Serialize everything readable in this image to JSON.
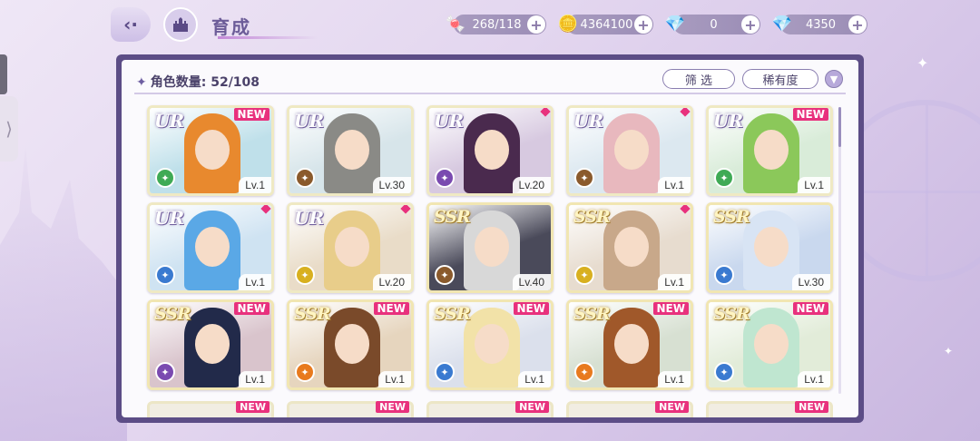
{
  "header": {
    "title": "育成",
    "back_icon": "back-arrow-icon",
    "home_icon": "castle-home-icon"
  },
  "currencies": [
    {
      "name": "candy",
      "icon": "🍬",
      "value": "268/118"
    },
    {
      "name": "coin",
      "icon": "🪙",
      "value": "4364100"
    },
    {
      "name": "pink-diamond",
      "icon": "💎",
      "value": "0"
    },
    {
      "name": "blue-diamond",
      "icon": "💎",
      "value": "4350"
    }
  ],
  "panel": {
    "count_label": "角色数量: 52/108",
    "filter_label": "筛 选",
    "rarity_label": "稀有度",
    "dropdown_icon": "chevron-down-icon"
  },
  "colors": {
    "new_tag": "#e8317d",
    "panel_frame": "#5c4d86",
    "accent": "#6d5da0"
  },
  "cards": [
    {
      "rarity": "UR",
      "tag": "NEW",
      "level": "Lv.1",
      "attr_color": "#3faa55",
      "hair": "#e8892e",
      "bg": "#bfe0ea"
    },
    {
      "rarity": "UR",
      "tag": "",
      "level": "Lv.30",
      "attr_color": "#8a5a2c",
      "hair": "#8a8a86",
      "bg": "#d7e5ea"
    },
    {
      "rarity": "UR",
      "tag": "dot",
      "level": "Lv.20",
      "attr_color": "#7a4ab0",
      "hair": "#4a2a4e",
      "bg": "#d7c9e0"
    },
    {
      "rarity": "UR",
      "tag": "dot",
      "level": "Lv.1",
      "attr_color": "#8a5a2c",
      "hair": "#e8b8be",
      "bg": "#dce8f0"
    },
    {
      "rarity": "UR",
      "tag": "NEW",
      "level": "Lv.1",
      "attr_color": "#3faa55",
      "hair": "#8bc85a",
      "bg": "#d9ecd9"
    },
    {
      "rarity": "UR",
      "tag": "dot",
      "level": "Lv.1",
      "attr_color": "#3a7ad0",
      "hair": "#5aa8e6",
      "bg": "#cfe3f2"
    },
    {
      "rarity": "UR",
      "tag": "dot",
      "level": "Lv.20",
      "attr_color": "#d8b020",
      "hair": "#e8cd8a",
      "bg": "#e9dcc8"
    },
    {
      "rarity": "SSR",
      "tag": "",
      "level": "Lv.40",
      "attr_color": "#8a5a2c",
      "hair": "#d8d8d8",
      "bg": "#4a4a5a"
    },
    {
      "rarity": "SSR",
      "tag": "dot",
      "level": "Lv.1",
      "attr_color": "#d8b020",
      "hair": "#c8a88a",
      "bg": "#e7dccf"
    },
    {
      "rarity": "SSR",
      "tag": "",
      "level": "Lv.30",
      "attr_color": "#3a7ad0",
      "hair": "#d8e4f4",
      "bg": "#c9d8ee"
    },
    {
      "rarity": "SSR",
      "tag": "NEW",
      "level": "Lv.1",
      "attr_color": "#7a4ab0",
      "hair": "#222a4a",
      "bg": "#d9c4cc"
    },
    {
      "rarity": "SSR",
      "tag": "NEW",
      "level": "Lv.1",
      "attr_color": "#e87a1e",
      "hair": "#7a4a2a",
      "bg": "#e6d5be"
    },
    {
      "rarity": "SSR",
      "tag": "NEW",
      "level": "Lv.1",
      "attr_color": "#3a7ad0",
      "hair": "#f2e2a8",
      "bg": "#dbe0ec"
    },
    {
      "rarity": "SSR",
      "tag": "NEW",
      "level": "Lv.1",
      "attr_color": "#e87a1e",
      "hair": "#a0582a",
      "bg": "#d7e0d2"
    },
    {
      "rarity": "SSR",
      "tag": "NEW",
      "level": "Lv.1",
      "attr_color": "#3a7ad0",
      "hair": "#bfe6d0",
      "bg": "#e2ecd9"
    }
  ],
  "peek_row": [
    {
      "tag": "NEW"
    },
    {
      "tag": "NEW"
    },
    {
      "tag": "NEW"
    },
    {
      "tag": "NEW"
    },
    {
      "tag": "NEW"
    }
  ]
}
